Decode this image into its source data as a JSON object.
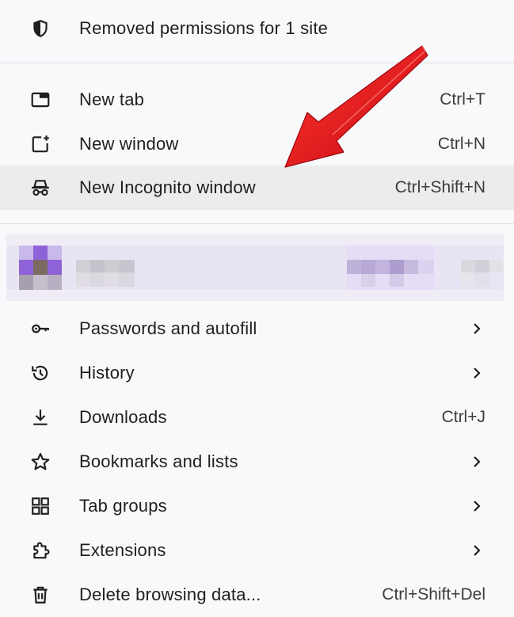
{
  "menu": {
    "header": {
      "label": "Removed permissions for 1 site",
      "icon": "shield-icon"
    },
    "top_items": [
      {
        "label": "New tab",
        "shortcut": "Ctrl+T",
        "icon": "new-tab-icon"
      },
      {
        "label": "New window",
        "shortcut": "Ctrl+N",
        "icon": "new-window-icon"
      },
      {
        "label": "New Incognito window",
        "shortcut": "Ctrl+Shift+N",
        "icon": "incognito-icon",
        "highlighted": true
      }
    ],
    "bottom_items": [
      {
        "label": "Passwords and autofill",
        "icon": "key-icon",
        "submenu": true
      },
      {
        "label": "History",
        "icon": "history-icon",
        "submenu": true
      },
      {
        "label": "Downloads",
        "shortcut": "Ctrl+J",
        "icon": "download-icon"
      },
      {
        "label": "Bookmarks and lists",
        "icon": "star-icon",
        "submenu": true
      },
      {
        "label": "Tab groups",
        "icon": "tab-groups-icon",
        "submenu": true
      },
      {
        "label": "Extensions",
        "icon": "puzzle-icon",
        "submenu": true
      },
      {
        "label": "Delete browsing data...",
        "shortcut": "Ctrl+Shift+Del",
        "icon": "trash-icon"
      }
    ]
  },
  "profile": {
    "redacted": true
  },
  "colors": {
    "menu_background": "#f8f9fa",
    "highlight": "#ebecee",
    "divider": "#dadce0",
    "annotation_arrow": "#e8141c",
    "profile_accent": "#8e63d8"
  }
}
